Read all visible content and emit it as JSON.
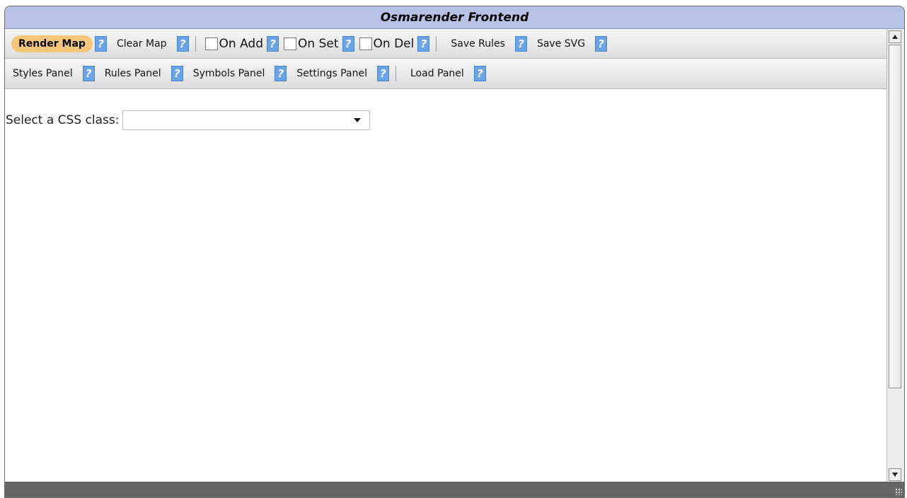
{
  "window": {
    "title": "Osmarender Frontend"
  },
  "toolbar1": {
    "render_map": "Render Map",
    "clear_map": "Clear Map",
    "on_add": "On Add",
    "on_set": "On Set",
    "on_del": "On Del",
    "save_rules": "Save Rules",
    "save_svg": "Save SVG",
    "help": "?"
  },
  "toolbar2": {
    "styles_panel": "Styles Panel",
    "rules_panel": "Rules Panel",
    "symbols_panel": "Symbols Panel",
    "settings_panel": "Settings Panel",
    "load_panel": "Load Panel",
    "help": "?"
  },
  "content": {
    "select_label": "Select a CSS class:",
    "select_value": ""
  },
  "colors": {
    "title_bar": "#b8c1e6",
    "active_button": "#f6c77a",
    "help_icon": "#6aa3e8",
    "status_bar": "#666666"
  }
}
